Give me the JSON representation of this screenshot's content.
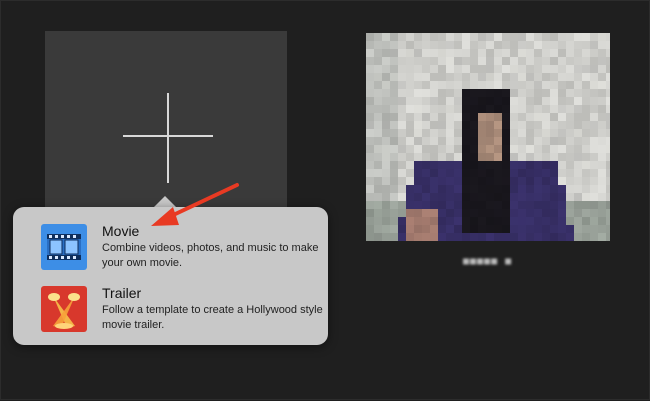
{
  "new_project": {
    "icon": "plus-icon"
  },
  "project": {
    "name": "■■■■■ ■"
  },
  "menu": {
    "items": [
      {
        "title": "Movie",
        "description": "Combine videos, photos, and music to make your own movie.",
        "icon": "film-strip-icon",
        "icon_color": "#3d8ee6"
      },
      {
        "title": "Trailer",
        "description": "Follow a template to create a Hollywood style movie trailer.",
        "icon": "spotlights-icon",
        "icon_color": "#d8382c"
      }
    ]
  },
  "colors": {
    "background": "#1f1f1f",
    "tile": "#3a3a3a",
    "popover": "#c8c8c8",
    "annotation_arrow": "#e83a23"
  }
}
